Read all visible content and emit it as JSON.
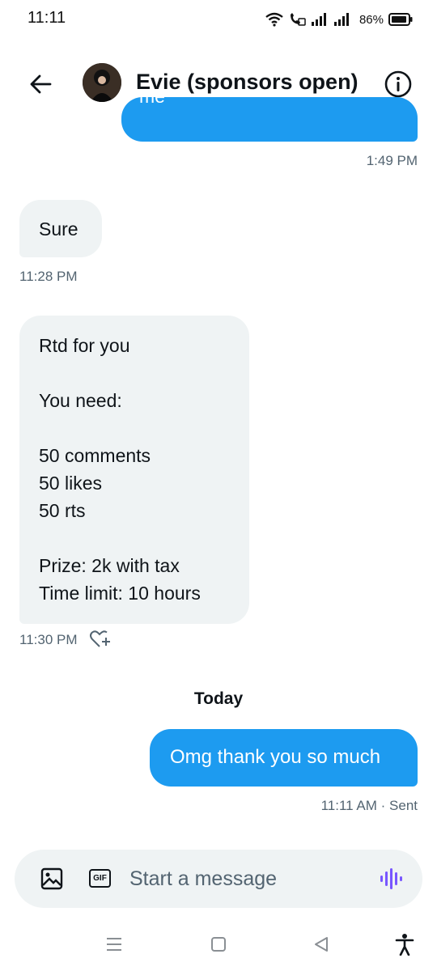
{
  "status_bar": {
    "time": "11:11",
    "battery": "86%"
  },
  "header": {
    "contact_name": "Evie (sponsors open)"
  },
  "messages": [
    {
      "type": "sent",
      "text": "me",
      "timestamp": "1:49 PM"
    },
    {
      "type": "received",
      "text": "Sure",
      "timestamp": "11:28 PM"
    },
    {
      "type": "received",
      "lines": [
        "Rtd for you",
        "",
        "You need:",
        "",
        "50 comments",
        "50 likes",
        "50 rts",
        "",
        "Prize: 2k with tax",
        "Time limit: 10  hours"
      ],
      "timestamp": "11:30 PM"
    },
    {
      "type": "sent",
      "text": "Omg thank you so much",
      "timestamp": "11:11 AM · Sent"
    }
  ],
  "date_divider": "Today",
  "composer": {
    "placeholder": "Start a message",
    "gif_label": "GIF"
  },
  "colors": {
    "accent": "#1d9bf0",
    "received_bubble": "#eff3f4",
    "muted_text": "#536471",
    "voice_icon": "#7856ff"
  },
  "icons": [
    "back-arrow-icon",
    "info-icon",
    "add-reaction-icon",
    "image-icon",
    "gif-icon",
    "voice-icon",
    "menu-icon",
    "home-icon",
    "back-icon",
    "accessibility-icon"
  ]
}
